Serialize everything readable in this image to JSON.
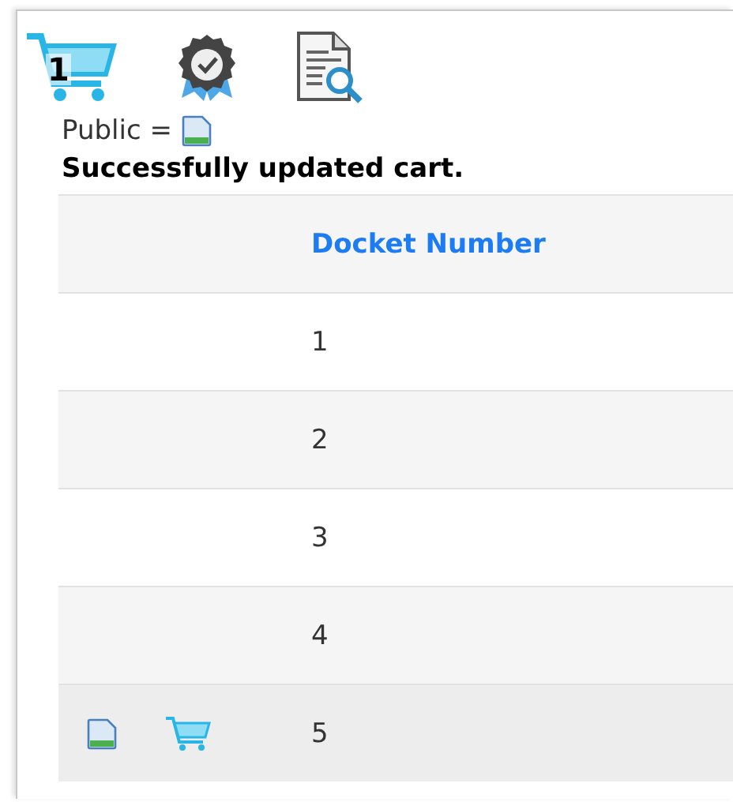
{
  "toolbar": {
    "cart_count": "1"
  },
  "legend": {
    "label": "Public ="
  },
  "message": "Successfully updated cart.",
  "table": {
    "columns": [
      "Docket Number"
    ],
    "rows": [
      {
        "docket": "1",
        "public": false,
        "in_cart": false,
        "highlighted": false
      },
      {
        "docket": "2",
        "public": false,
        "in_cart": false,
        "highlighted": false
      },
      {
        "docket": "3",
        "public": false,
        "in_cart": false,
        "highlighted": false
      },
      {
        "docket": "4",
        "public": false,
        "in_cart": false,
        "highlighted": false
      },
      {
        "docket": "5",
        "public": true,
        "in_cart": true,
        "highlighted": true
      }
    ]
  }
}
